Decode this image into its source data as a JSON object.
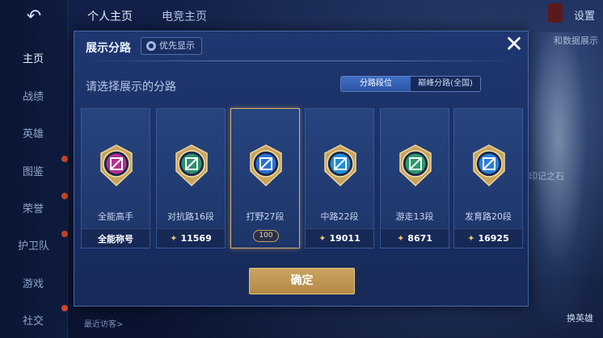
{
  "sidebar": {
    "back_icon": "back-arrow-icon",
    "items": [
      {
        "label": "主页",
        "active": true
      },
      {
        "label": "战绩",
        "active": false
      },
      {
        "label": "英雄",
        "active": false
      },
      {
        "label": "图鉴",
        "active": false
      },
      {
        "label": "荣誉",
        "active": false
      },
      {
        "label": "护卫队",
        "active": false
      },
      {
        "label": "游戏",
        "active": false
      },
      {
        "label": "社交",
        "active": false
      }
    ]
  },
  "topbar": {
    "tabs": [
      "个人主页",
      "电竞主页"
    ],
    "settings_label": "设置"
  },
  "background": {
    "tag_right": "和数据展示",
    "tag_mid": "印记之石",
    "swap_hero_label": "换英雄",
    "recent_visitors_label": "最近访客>"
  },
  "dialog": {
    "title": "展示分路",
    "priority_label": "优先显示",
    "close_icon": "close-icon",
    "prompt": "请选择展示的分路",
    "segment": {
      "options": [
        "分路段位",
        "巅峰分路(全国)"
      ],
      "selected_index": 0
    },
    "cards": [
      {
        "name": "全能高手",
        "footer": "全能称号",
        "has_star": false,
        "emblem_color": "#b0318e",
        "selected": false
      },
      {
        "name": "对抗路16段",
        "footer": "11569",
        "has_star": true,
        "emblem_color": "#2e8f6e",
        "selected": false
      },
      {
        "name": "打野27段",
        "footer": "",
        "has_star": false,
        "emblem_color": "#2a6fd1",
        "selected": true,
        "stars_badge": "100"
      },
      {
        "name": "中路22段",
        "footer": "19011",
        "has_star": true,
        "emblem_color": "#1f8fd8",
        "selected": false
      },
      {
        "name": "游走13段",
        "footer": "8671",
        "has_star": true,
        "emblem_color": "#2a9a6a",
        "selected": false
      },
      {
        "name": "发育路20段",
        "footer": "16925",
        "has_star": true,
        "emblem_color": "#2a7fd8",
        "selected": false
      }
    ],
    "confirm_label": "确定"
  },
  "colors": {
    "accent_gold": "#c9a460",
    "dialog_bg": "#1f3770",
    "segment_active": "#3f6fc6"
  }
}
